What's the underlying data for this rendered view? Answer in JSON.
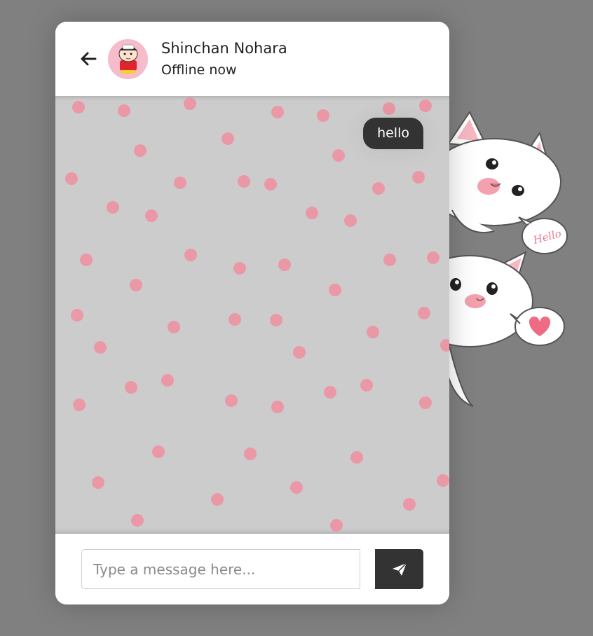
{
  "contact": {
    "name": "Shinchan Nohara",
    "status": "Offline now"
  },
  "messages": [
    {
      "direction": "outgoing",
      "text": "hello"
    }
  ],
  "composer": {
    "placeholder": "Type a message here...",
    "value": ""
  },
  "decoration": {
    "speech_bubble_text": "Hello"
  },
  "icons": {
    "back": "arrow-left-icon",
    "send": "paper-plane-icon"
  },
  "colors": {
    "page_background": "#808080",
    "chat_background": "#cccccc",
    "dot_pink": "#f08fa0",
    "bubble_dark": "#333333",
    "send_button": "#333333"
  }
}
